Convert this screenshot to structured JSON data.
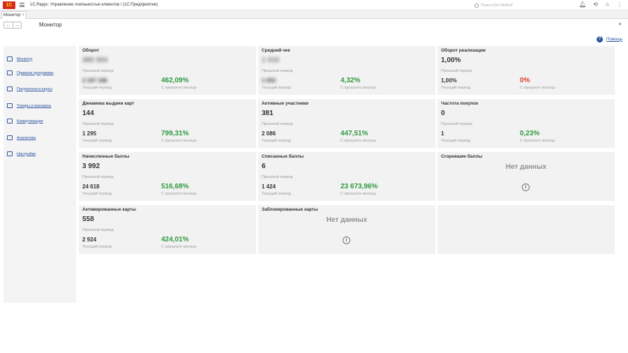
{
  "app": {
    "logo": "1С",
    "title": "1С:Рарус: Управление лояльностью клиентов / (1С:Предприятие)",
    "search_placeholder": "Поиск Ctrl+Shift+F"
  },
  "tabs": [
    {
      "label": "Монитор",
      "close": "×"
    }
  ],
  "form": {
    "back": "←",
    "forward": "→",
    "title": "Монитор",
    "close": "×",
    "help_label": "Помощь"
  },
  "sidebar": {
    "items": [
      {
        "label": "Монитор",
        "icon": "home-icon"
      },
      {
        "label": "Правила программы",
        "icon": "grid-icon"
      },
      {
        "label": "Покупатели и карты",
        "icon": "card-icon"
      },
      {
        "label": "Товары и магазины",
        "icon": "basket-icon"
      },
      {
        "label": "Коммуникации",
        "icon": "chat-icon"
      },
      {
        "label": "Аналитика",
        "icon": "chart-icon"
      },
      {
        "label": "Настройки",
        "icon": "settings-icon"
      }
    ]
  },
  "cards": {
    "turnover": {
      "title": "Оборот",
      "prev_value": "385 554",
      "prev_label": "Прошлый период",
      "cur_value": "2 167 166",
      "cur_label": "Текущий период",
      "pct": "462,09%",
      "pct_label": "С прошлого месяца"
    },
    "avg_check": {
      "title": "Средний чек",
      "prev_value": "1 010",
      "prev_label": "Прошлый период",
      "cur_value": "1 053",
      "cur_label": "Текущий период",
      "pct": "4,32%",
      "pct_label": "С прошлого месяца"
    },
    "sales_turnover": {
      "title": "Оборот реализации",
      "prev_value": "1,00%",
      "prev_label": "Прошлый период",
      "cur_value": "1,00%",
      "cur_label": "Текущий период",
      "pct": "0%",
      "pct_label": "С прошлого месяца"
    },
    "card_issue": {
      "title": "Динамика выдачи карт",
      "prev_value": "144",
      "prev_label": "Прошлый период",
      "cur_value": "1 295",
      "cur_label": "Текущий период",
      "pct": "799,31%",
      "pct_label": "С прошлого месяца"
    },
    "active_members": {
      "title": "Активные участники",
      "prev_value": "381",
      "prev_label": "Прошлый период",
      "cur_value": "2 086",
      "cur_label": "Текущий период",
      "pct": "447,51%",
      "pct_label": "С прошлого месяца"
    },
    "purchase_freq": {
      "title": "Частота покупок",
      "prev_value": "0",
      "prev_label": "Прошлый период",
      "cur_value": "1",
      "cur_label": "Текущий период",
      "pct": "0,23%",
      "pct_label": "С прошлого месяца"
    },
    "accrued_points": {
      "title": "Начисленные баллы",
      "prev_value": "3 992",
      "prev_label": "Прошлый период",
      "cur_value": "24 618",
      "cur_label": "Текущий период",
      "pct": "516,68%",
      "pct_label": "С прошлого месяца"
    },
    "spent_points": {
      "title": "Списанные баллы",
      "prev_value": "6",
      "prev_label": "Прошлый период",
      "cur_value": "1 424",
      "cur_label": "Текущий период",
      "pct": "23 673,96%",
      "pct_label": "С прошлого месяца"
    },
    "burned_points": {
      "title": "Сгоревшие баллы",
      "no_data": "Нет данных"
    },
    "activated_cards": {
      "title": "Активированные карты",
      "prev_value": "558",
      "prev_label": "Прошлый период",
      "cur_value": "2 924",
      "cur_label": "Текущий период",
      "pct": "424,01%",
      "pct_label": "С прошлого месяца"
    },
    "blocked_cards": {
      "title": "Заблокированные карты",
      "no_data": "Нет данных"
    }
  },
  "colors": {
    "positive": "#2e9a3e",
    "negative": "#d9442e",
    "link": "#2a54a0",
    "card_bg": "#f2f2f2"
  }
}
